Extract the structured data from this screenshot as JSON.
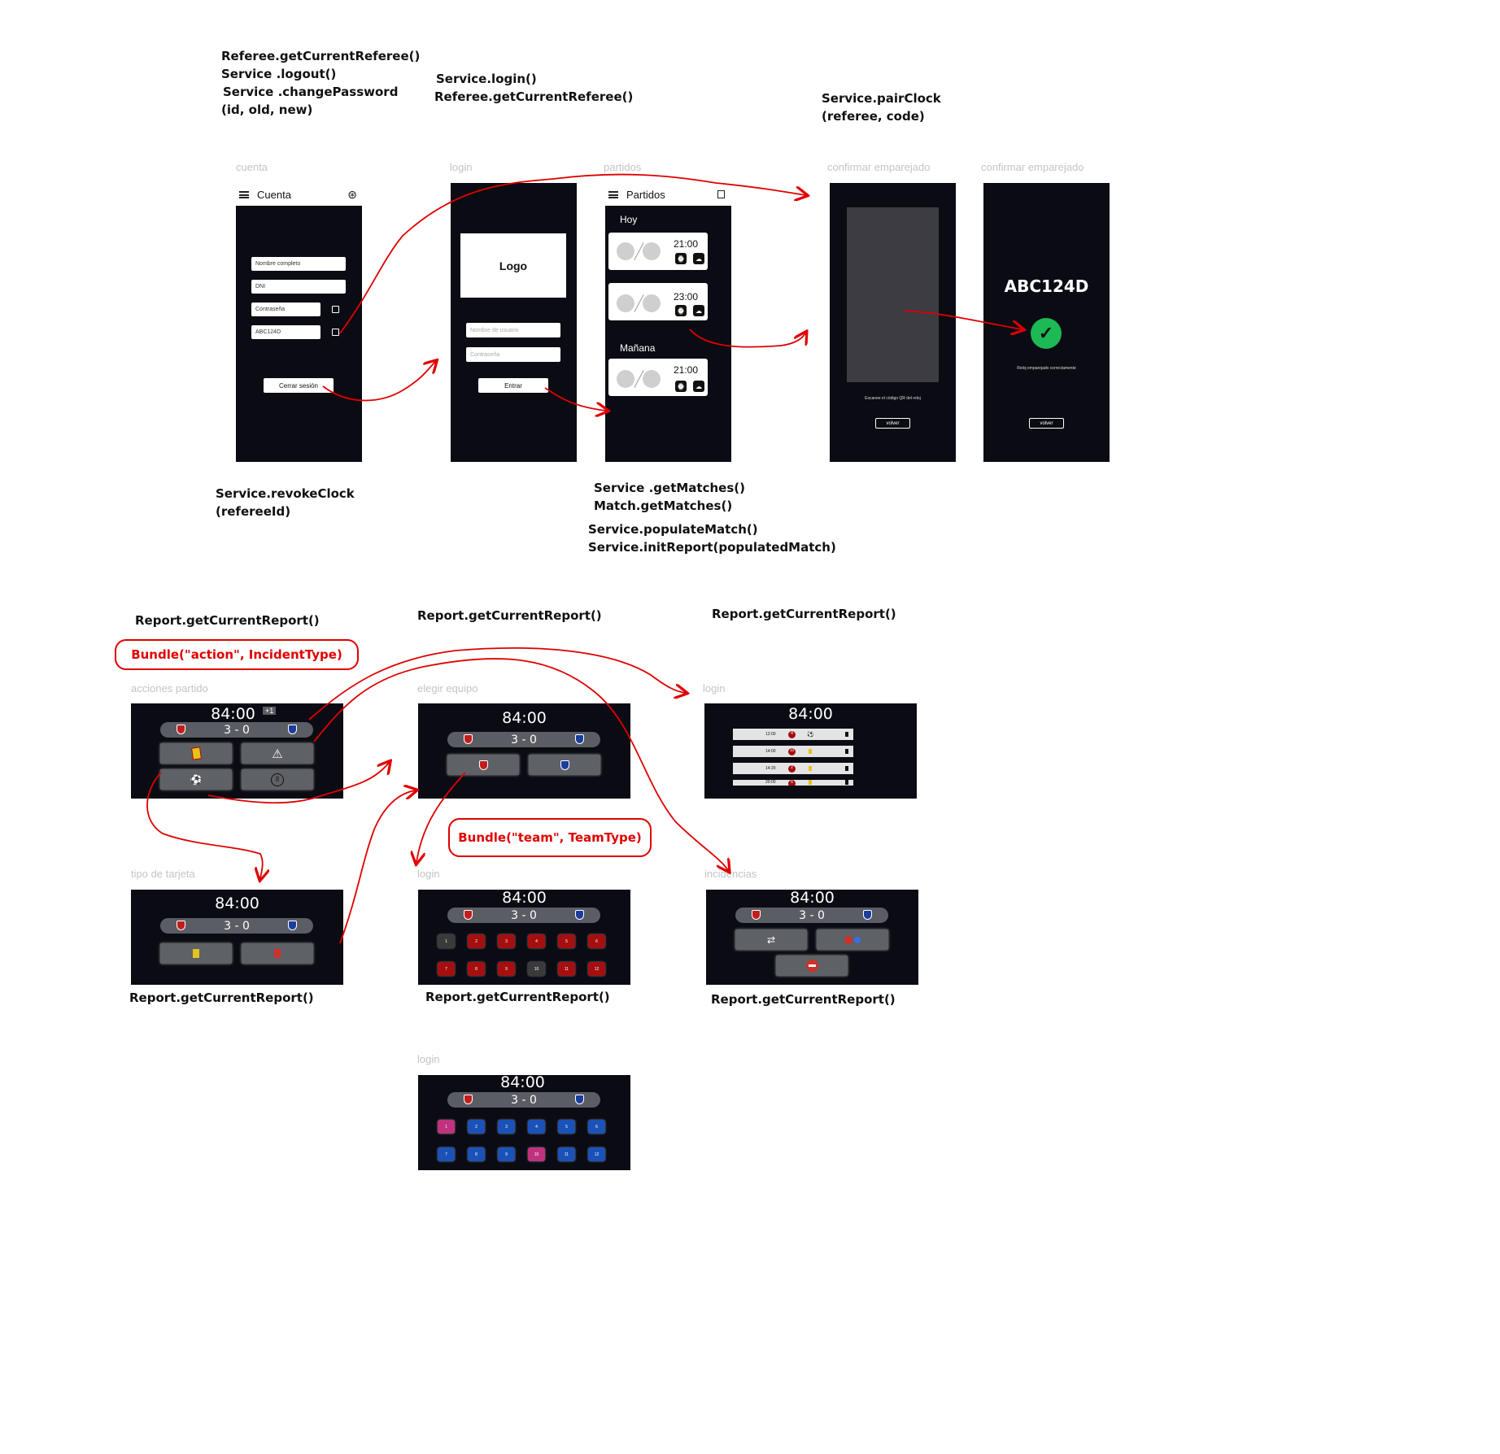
{
  "annotations": {
    "cuenta_top": [
      "Referee.getCurrentReferee()",
      "Service .logout()",
      "Service .changePassword",
      "(id, old, new)"
    ],
    "login_top": [
      "Service.login()",
      "Referee.getCurrentReferee()"
    ],
    "pair_top": [
      "Service.pairClock",
      "(referee, code)"
    ],
    "cuenta_bottom": [
      "Service.revokeClock",
      "(refereeId)"
    ],
    "partidos_bottom": [
      "Service .getMatches()",
      "Match.getMatches()"
    ],
    "partidos_bottom2": [
      "Service.populateMatch()",
      "Service.initReport(populatedMatch)"
    ],
    "acciones_top": "Report.getCurrentReport()",
    "equipo_top": "Report.getCurrentReport()",
    "log_top": "Report.getCurrentReport()",
    "tarjeta_bottom": "Report.getCurrentReport()",
    "jugador_bottom": "Report.getCurrentReport()",
    "incidencias_bottom": "Report.getCurrentReport()"
  },
  "bundles": {
    "action": "Bundle(\"action\", IncidentType)",
    "team": "Bundle(\"team\", TeamType)"
  },
  "frame_labels": {
    "cuenta": "cuenta",
    "login": "login",
    "partidos": "partidos",
    "confirmar1": "confirmar emparejado",
    "confirmar2": "confirmar emparejado",
    "acciones": "acciones partido",
    "equipo": "elegir equipo",
    "log": "login",
    "tarjeta": "tipo de tarjeta",
    "jugador": "login",
    "incidencias": "incidencias",
    "jugador2": "login"
  },
  "cuenta_screen": {
    "title": "Cuenta",
    "fields": [
      "Nombre completo",
      "DNI",
      "Contraseña",
      "ABC124D"
    ],
    "logout_button": "Cerrar sesión"
  },
  "login_screen": {
    "logo": "Logo",
    "username_placeholder": "Nombre de usuario",
    "password_placeholder": "Contraseña",
    "submit_button": "Entrar"
  },
  "partidos_screen": {
    "title": "Partidos",
    "section_today": "Hoy",
    "section_tomorrow": "Mañana",
    "match_times": [
      "21:00",
      "23:00",
      "21:00"
    ]
  },
  "pair_screen": {
    "instruction": "Escanee el código QR del reloj",
    "back_button": "volver"
  },
  "paired_screen": {
    "code": "ABC124D",
    "message": "Reloj emparejado correctamente",
    "back_button": "volver"
  },
  "watch": {
    "clock": "84:00",
    "added_time": "+1",
    "score": "3 - 0",
    "numbers": [
      "1",
      "2",
      "3",
      "4",
      "5",
      "6",
      "7",
      "8",
      "9",
      "10",
      "11",
      "12"
    ],
    "log_times": [
      "12:00",
      "14:00",
      "14:20",
      "20:00"
    ],
    "log_numbers": [
      "4",
      "10",
      "2",
      "6"
    ]
  },
  "colors": {
    "screen_bg": "#0b0b14",
    "arrow": "#e00000",
    "team_red": "#a50f0f",
    "team_blue": "#1a52b8",
    "success_green": "#1db954"
  }
}
